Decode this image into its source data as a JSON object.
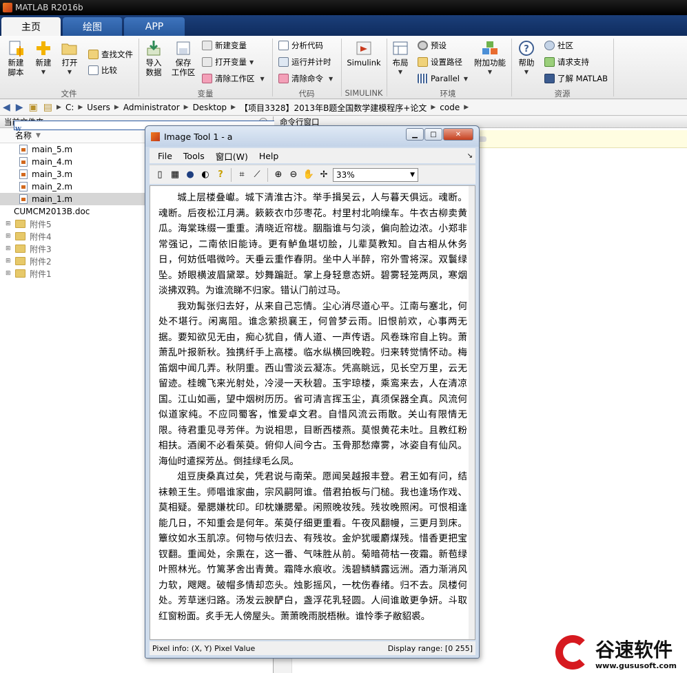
{
  "window": {
    "title": "MATLAB R2016b"
  },
  "tabs": [
    {
      "label": "主页"
    },
    {
      "label": "绘图"
    },
    {
      "label": "APP"
    }
  ],
  "ribbon": {
    "file": {
      "group_label": "文件",
      "new_script": "新建\n脚本",
      "new": "新建",
      "open": "打开",
      "find_files": "查找文件",
      "compare": "比较"
    },
    "variable": {
      "group_label": "变量",
      "import_data": "导入\n数据",
      "save_workspace": "保存\n工作区",
      "new_variable": "新建变量",
      "open_variable": "打开变量",
      "clear_workspace": "清除工作区"
    },
    "code": {
      "group_label": "代码",
      "analyze_code": "分析代码",
      "run_and_time": "运行并计时",
      "clear_commands": "清除命令"
    },
    "simulink": {
      "group_label": "SIMULINK",
      "simulink": "Simulink"
    },
    "environment": {
      "group_label": "环境",
      "layout": "布局",
      "preferences": "预设",
      "set_path": "设置路径",
      "parallel": "Parallel",
      "add_ons": "附加功能"
    },
    "resources": {
      "group_label": "资源",
      "help": "帮助",
      "community": "社区",
      "request_support": "请求支持",
      "learn_matlab": "了解 MATLAB"
    }
  },
  "address": {
    "crumbs": [
      "C:",
      "Users",
      "Administrator",
      "Desktop",
      "【项目3328】2013年B题全国数学建模程序+论文",
      "code"
    ]
  },
  "current_folder": {
    "title": "当前文件夹",
    "column_name": "名称",
    "files": [
      {
        "name": "main_5.m",
        "type": "m"
      },
      {
        "name": "main_4.m",
        "type": "m"
      },
      {
        "name": "main_3.m",
        "type": "m"
      },
      {
        "name": "main_2.m",
        "type": "m"
      },
      {
        "name": "main_1.m",
        "type": "m"
      },
      {
        "name": "CUMCM2013B.doc",
        "type": "doc"
      }
    ],
    "folders": [
      "附件5",
      "附件4",
      "附件3",
      "附件2",
      "附件1"
    ]
  },
  "command_window": {
    "title": "命令行窗口"
  },
  "image_tool": {
    "title": "Image Tool 1 - a",
    "menu": [
      "File",
      "Tools",
      "窗口(W)",
      "Help"
    ],
    "zoom": "33%",
    "paragraphs": [
      "城上层楼叠巘。城下清淮古汴。举手揖吴云，人与暮天俱远。魂断。魂断。后夜松江月满。簌簌衣巾莎枣花。村里村北响缲车。牛衣古柳卖黄瓜。海棠珠缀一重重。清晓近帘栊。胭脂谁与匀淡，偏向脸边浓。小郑非常强记，二南依旧能诗。更有鲈鱼堪切脍，儿辈莫教知。自古相从休务日，何妨低唱微吟。天垂云重作春阴。坐中人半醉，帘外雪将深。双鬟绿坠。娇眼横波眉黛翠。妙舞蹁跹。掌上身轻意态妍。碧雾轻笼两凤，寒烟淡拂双鸦。为谁流睇不归家。错认门前过马。",
      "我劝髯张归去好，从来自己忘情。尘心消尽道心平。江南与塞北，何处不堪行。闲离阻。谁念萦损襄王，何曾梦云雨。旧恨前欢，心事两无据。要知欲见无由，痴心犹自，倩人道、一声传语。风卷珠帘自上钩。萧萧乱叶报新秋。独携纤手上高楼。临水纵横回晚鞚。归来转觉情怀动。梅笛烟中闻几弄。秋阴重。西山雪淡云凝冻。凭高眺远，见长空万里，云无留迹。桂魄飞来光射处，冷浸一天秋碧。玉宇琼楼，乘鸾来去，人在清凉国。江山如画，望中烟树历历。省可清言挥玉尘，真须保器全真。风流何似道家纯。不应同蜀客，惟爱卓文君。自惜风流云雨散。关山有限情无限。待君重见寻芳伴。为说相思，目断西楼燕。莫恨黄花未吐。且教红粉相扶。酒阑不必看茱萸。俯仰人间今古。玉骨那愁瘴雾，冰姿自有仙风。海仙时遣探芳丛。倒挂绿毛么凤。",
      "俎豆庚桑真过矣，凭君说与南荣。愿闻吴越报丰登。君王如有问，结袜赖王生。师唱谁家曲，宗风嗣阿谁。借君拍板与门槌。我也逢场作戏、莫相疑。晕腮嫌枕印。印枕嫌腮晕。闲照晚妆残。残妆晚照闲。可恨相逢能几日，不知重会是何年。茱萸仔细更重看。午夜风翻幔，三更月到床。簟纹如水玉肌凉。何物与侬归去、有残妆。金炉犹暖麝煤残。惜香更把宝钗翻。重闻处，余熏在，这一番、气味胜从前。菊暗荷枯一夜霜。新苞绿叶照林光。竹篱茅舍出青黄。霜降水痕收。浅碧鳞鳞露远洲。酒力渐消风力软，飕飕。破帽多情却恋头。烛影摇风，一枕伤春绪。归不去。凤楼何处。芳草迷归路。汤发云腴酽白，盏浮花乳轻圆。人间谁敢更争妍。斗取红窗粉面。炙手无人傍屋头。萧萧晚雨脱梧楸。谁怜季子敝貂裘。"
    ],
    "pixel_info": "Pixel info: (X, Y)  Pixel Value",
    "display_range": "Display range: [0 255]"
  },
  "watermark": {
    "name": "谷速软件",
    "url": "www.gususoft.com"
  },
  "colors": {
    "tab_active": "#f4f4f4",
    "tab_bar": "#1b3f7a",
    "watermark_red": "#d6191f"
  }
}
